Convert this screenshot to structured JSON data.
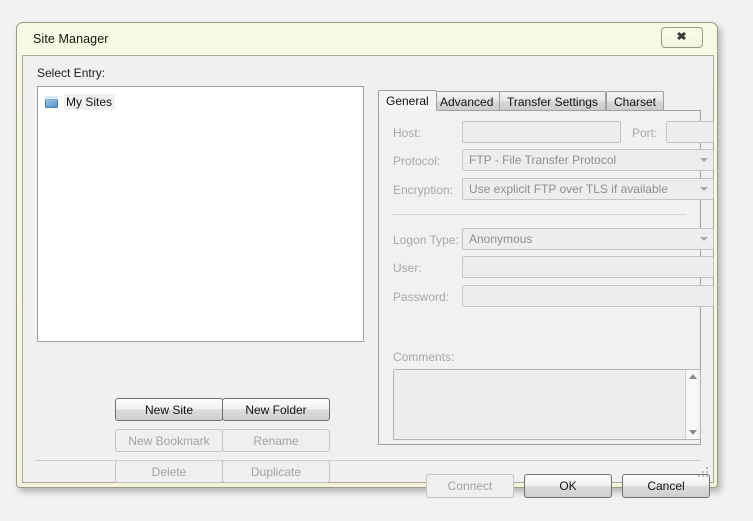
{
  "window": {
    "title": "Site Manager",
    "close_label": "✖",
    "close_icon": "close-icon"
  },
  "left": {
    "select_entry_label": "Select Entry:",
    "tree": [
      {
        "label": "My Sites",
        "icon": "site-folder-icon",
        "selected": true
      }
    ],
    "buttons": [
      {
        "label": "New Site",
        "enabled": true
      },
      {
        "label": "New Folder",
        "enabled": true
      },
      {
        "label": "New Bookmark",
        "enabled": false
      },
      {
        "label": "Rename",
        "enabled": false
      },
      {
        "label": "Delete",
        "enabled": false
      },
      {
        "label": "Duplicate",
        "enabled": false
      }
    ]
  },
  "right": {
    "tabs": [
      {
        "label": "General",
        "active": true
      },
      {
        "label": "Advanced",
        "active": false
      },
      {
        "label": "Transfer Settings",
        "active": false
      },
      {
        "label": "Charset",
        "active": false
      }
    ],
    "fields": {
      "host_label": "Host:",
      "host_value": "",
      "port_label": "Port:",
      "port_value": "",
      "protocol_label": "Protocol:",
      "protocol_value": "FTP - File Transfer Protocol",
      "encryption_label": "Encryption:",
      "encryption_value": "Use explicit FTP over TLS if available",
      "logon_type_label": "Logon Type:",
      "logon_type_value": "Anonymous",
      "user_label": "User:",
      "user_value": "",
      "password_label": "Password:",
      "password_value": "",
      "comments_label": "Comments:",
      "comments_value": ""
    }
  },
  "footer": {
    "buttons": [
      {
        "label": "Connect",
        "enabled": false
      },
      {
        "label": "OK",
        "enabled": true
      },
      {
        "label": "Cancel",
        "enabled": true
      }
    ]
  },
  "colors": {
    "window_frame": "#f6f7e0",
    "client_bg": "#f0f0f0",
    "tab_active_bg": "#f4f4f4",
    "disabled_text": "#a8a8a8",
    "tree_bg": "#ffffff"
  }
}
